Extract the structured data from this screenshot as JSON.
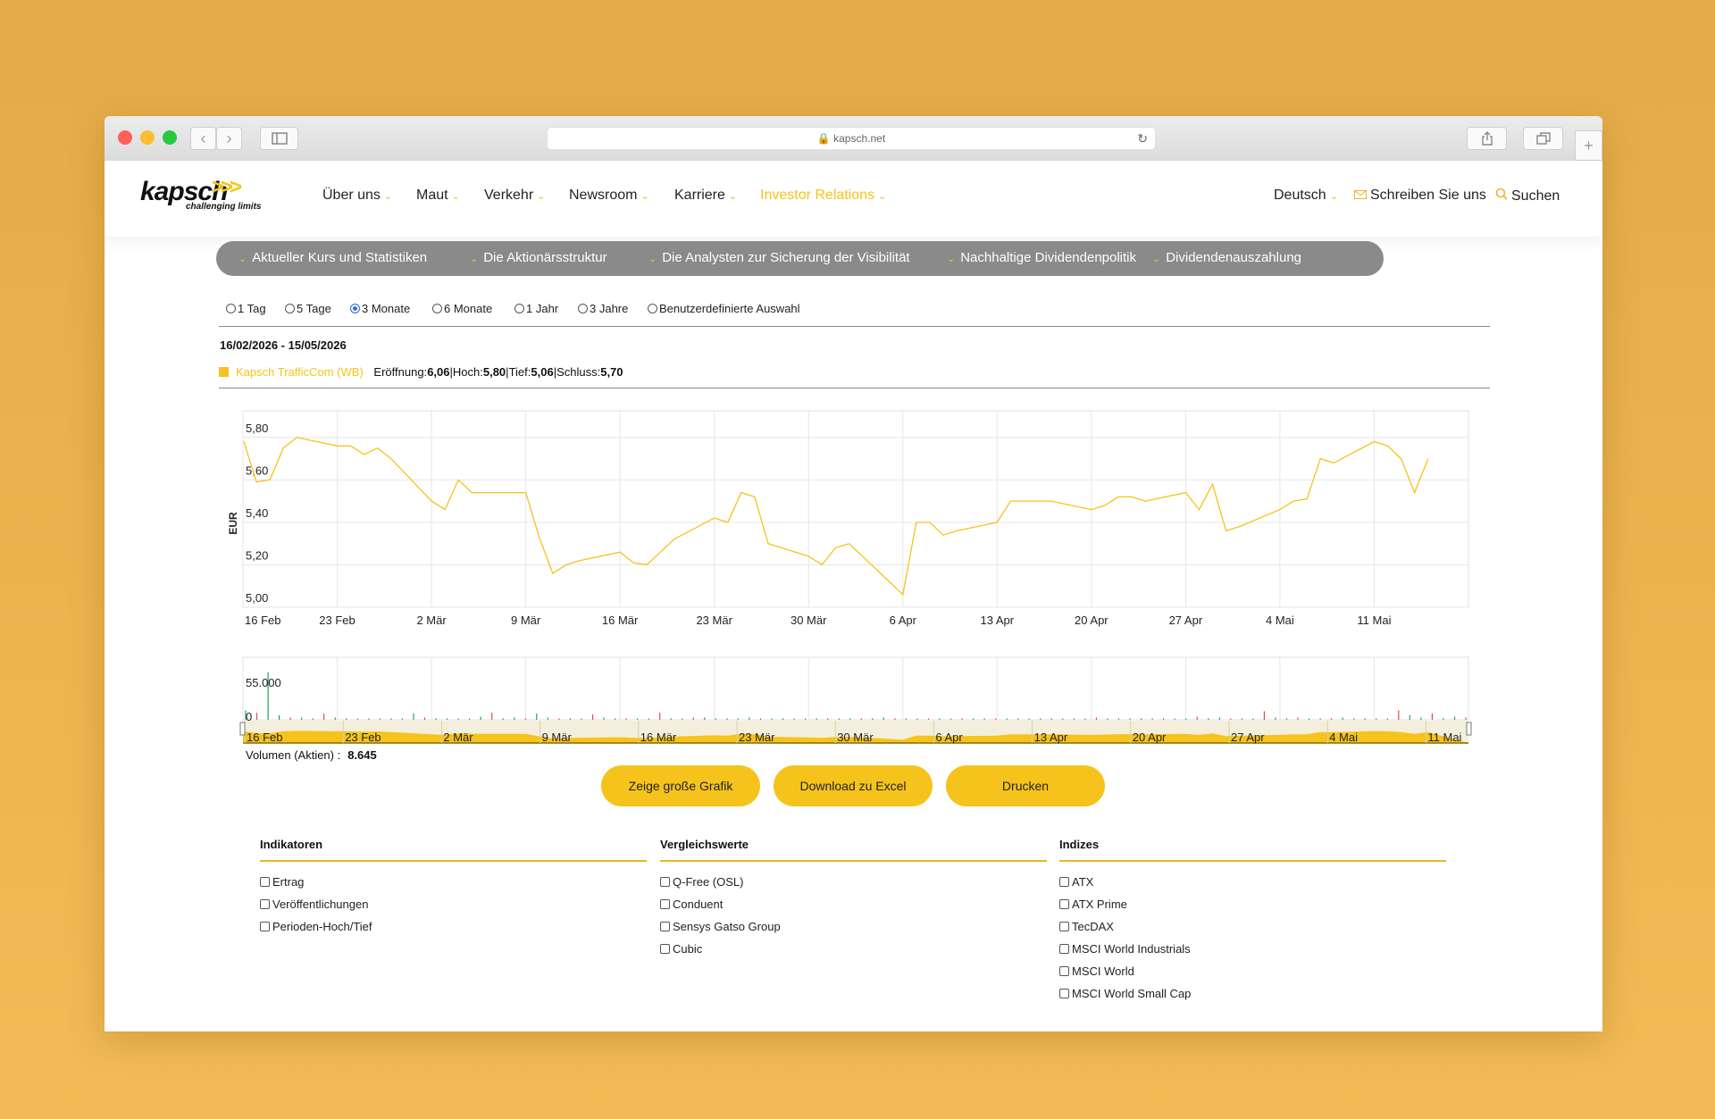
{
  "browser": {
    "url": "kapsch.net"
  },
  "logo": {
    "name": "kapsch",
    "arrows": ">>>",
    "tagline": "challenging limits"
  },
  "nav": {
    "items": [
      "Über uns",
      "Maut",
      "Verkehr",
      "Newsroom",
      "Karriere",
      "Investor Relations"
    ],
    "active": "Investor Relations",
    "language": "Deutsch",
    "contact": "Schreiben Sie uns",
    "search": "Suchen"
  },
  "subnav": {
    "items": [
      "Aktueller Kurs und Statistiken",
      "Die Aktionärsstruktur",
      "Die Analysten zur Sicherung der Visibilität",
      "Nachhaltige Dividendenpolitik",
      "Dividendenauszahlung"
    ]
  },
  "ranges": {
    "options": [
      "1 Tag",
      "5 Tage",
      "3 Monate",
      "6 Monate",
      "1 Jahr",
      "3 Jahre",
      "Benutzerdefinierte Auswahl"
    ],
    "selected": "3 Monate"
  },
  "quote": {
    "date_range": "16/02/2026 - 15/05/2026",
    "name": "Kapsch TrafficCom (WB)",
    "open_label": "Eröffnung:",
    "open": "6,06",
    "high_label": "Hoch:",
    "high": "5,80",
    "low_label": "Tief:",
    "low": "5,06",
    "close_label": "Schluss:",
    "close": "5,70",
    "volume_label": "Volumen (Aktien) :",
    "volume": "8.645"
  },
  "chart_data": {
    "type": "line",
    "ylabel": "EUR",
    "ylim": [
      5.0,
      5.9
    ],
    "yticks": [
      "5,80",
      "5,60",
      "5,40",
      "5,20",
      "5,00"
    ],
    "xticks": [
      "16 Feb",
      "23 Feb",
      "2 Mär",
      "9 Mär",
      "16 Mär",
      "23 Mär",
      "30 Mär",
      "6 Apr",
      "13 Apr",
      "20 Apr",
      "27 Apr",
      "4 Mai",
      "11 Mai"
    ],
    "color": "#f5c31b",
    "series": [
      {
        "x": [
          "2026-02-16",
          "2026-02-17",
          "2026-02-18",
          "2026-02-19",
          "2026-02-20",
          "2026-02-23",
          "2026-02-24",
          "2026-02-25",
          "2026-02-26",
          "2026-02-27",
          "2026-03-02",
          "2026-03-03",
          "2026-03-04",
          "2026-03-05",
          "2026-03-06",
          "2026-03-09",
          "2026-03-10",
          "2026-03-11",
          "2026-03-12",
          "2026-03-13",
          "2026-03-16",
          "2026-03-17",
          "2026-03-18",
          "2026-03-19",
          "2026-03-20",
          "2026-03-23",
          "2026-03-24",
          "2026-03-25",
          "2026-03-26",
          "2026-03-27",
          "2026-03-30",
          "2026-03-31",
          "2026-04-01",
          "2026-04-02",
          "2026-04-03",
          "2026-04-06",
          "2026-04-07",
          "2026-04-08",
          "2026-04-09",
          "2026-04-10",
          "2026-04-13",
          "2026-04-14",
          "2026-04-15",
          "2026-04-16",
          "2026-04-17",
          "2026-04-20",
          "2026-04-21",
          "2026-04-22",
          "2026-04-23",
          "2026-04-24",
          "2026-04-27",
          "2026-04-28",
          "2026-04-29",
          "2026-04-30",
          "2026-05-01",
          "2026-05-04",
          "2026-05-05",
          "2026-05-06",
          "2026-05-07",
          "2026-05-08",
          "2026-05-11",
          "2026-05-12",
          "2026-05-13",
          "2026-05-14",
          "2026-05-15"
        ],
        "values": [
          5.78,
          5.59,
          5.6,
          5.75,
          5.8,
          5.76,
          5.76,
          5.72,
          5.75,
          5.7,
          5.5,
          5.46,
          5.6,
          5.54,
          5.54,
          5.54,
          5.33,
          5.16,
          5.2,
          5.22,
          5.26,
          5.21,
          5.2,
          5.26,
          5.32,
          5.42,
          5.4,
          5.54,
          5.52,
          5.3,
          5.24,
          5.2,
          5.28,
          5.3,
          5.24,
          5.06,
          5.4,
          5.4,
          5.34,
          5.36,
          5.4,
          5.5,
          5.5,
          5.5,
          5.5,
          5.46,
          5.48,
          5.52,
          5.52,
          5.5,
          5.54,
          5.46,
          5.58,
          5.36,
          5.38,
          5.46,
          5.5,
          5.51,
          5.7,
          5.68,
          5.78,
          5.76,
          5.7,
          5.54,
          5.7
        ]
      }
    ],
    "volume": {
      "ytick_labels": [
        "55.000",
        "0"
      ],
      "ylim": [
        0,
        80000
      ],
      "values": [
        12000,
        9000,
        61000,
        6000,
        3000,
        3000,
        2000,
        8000,
        3000,
        2000,
        1000,
        1000,
        1000,
        1000,
        1000,
        8000,
        3000,
        2000,
        1000,
        1000,
        1000,
        4000,
        9000,
        2000,
        3000,
        1000,
        8000,
        3000,
        1000,
        2000,
        1000,
        7000,
        3000,
        1000,
        2000,
        1000,
        1000,
        9000,
        2000,
        1000,
        3000,
        3000,
        2000,
        2000,
        1000,
        3000,
        2000,
        1000,
        2000,
        1000,
        1000,
        1000,
        2000,
        1000,
        2000,
        1000,
        2000,
        3000,
        2000,
        1000,
        1000,
        1000,
        2000,
        1000,
        2000,
        1000,
        1000,
        1000,
        1000,
        1000,
        1000,
        1000,
        2000,
        1000,
        1000,
        1000,
        3000,
        2000,
        1000,
        1000,
        2000,
        1000,
        2000,
        1000,
        1000,
        4000,
        2000,
        3000,
        1000,
        1000,
        1000,
        11000,
        3000,
        2000,
        3000,
        1000,
        1000,
        2000,
        3000,
        1000,
        2000,
        1000,
        1000,
        12000,
        6000,
        3000,
        8000,
        2000,
        4000,
        3000
      ]
    }
  },
  "navigator": {
    "labels": [
      "16 Feb",
      "23 Feb",
      "2 Mär",
      "9 Mär",
      "16 Mär",
      "23 Mär",
      "30 Mär",
      "6 Apr",
      "13 Apr",
      "20 Apr",
      "27 Apr",
      "4 Mai",
      "11 Mai"
    ]
  },
  "buttons": {
    "big_chart": "Zeige große Grafik",
    "excel": "Download zu Excel",
    "print": "Drucken"
  },
  "panels": [
    {
      "title": "Indikatoren",
      "options": [
        "Ertrag",
        "Veröffentlichungen",
        "Perioden-Hoch/Tief"
      ]
    },
    {
      "title": "Vergleichswerte",
      "options": [
        "Q-Free (OSL)",
        "Conduent",
        "Sensys Gatso Group",
        "Cubic"
      ]
    },
    {
      "title": "Indizes",
      "options": [
        "ATX",
        "ATX Prime",
        "TecDAX",
        "MSCI World Industrials",
        "MSCI World",
        "MSCI World Small Cap"
      ]
    }
  ]
}
